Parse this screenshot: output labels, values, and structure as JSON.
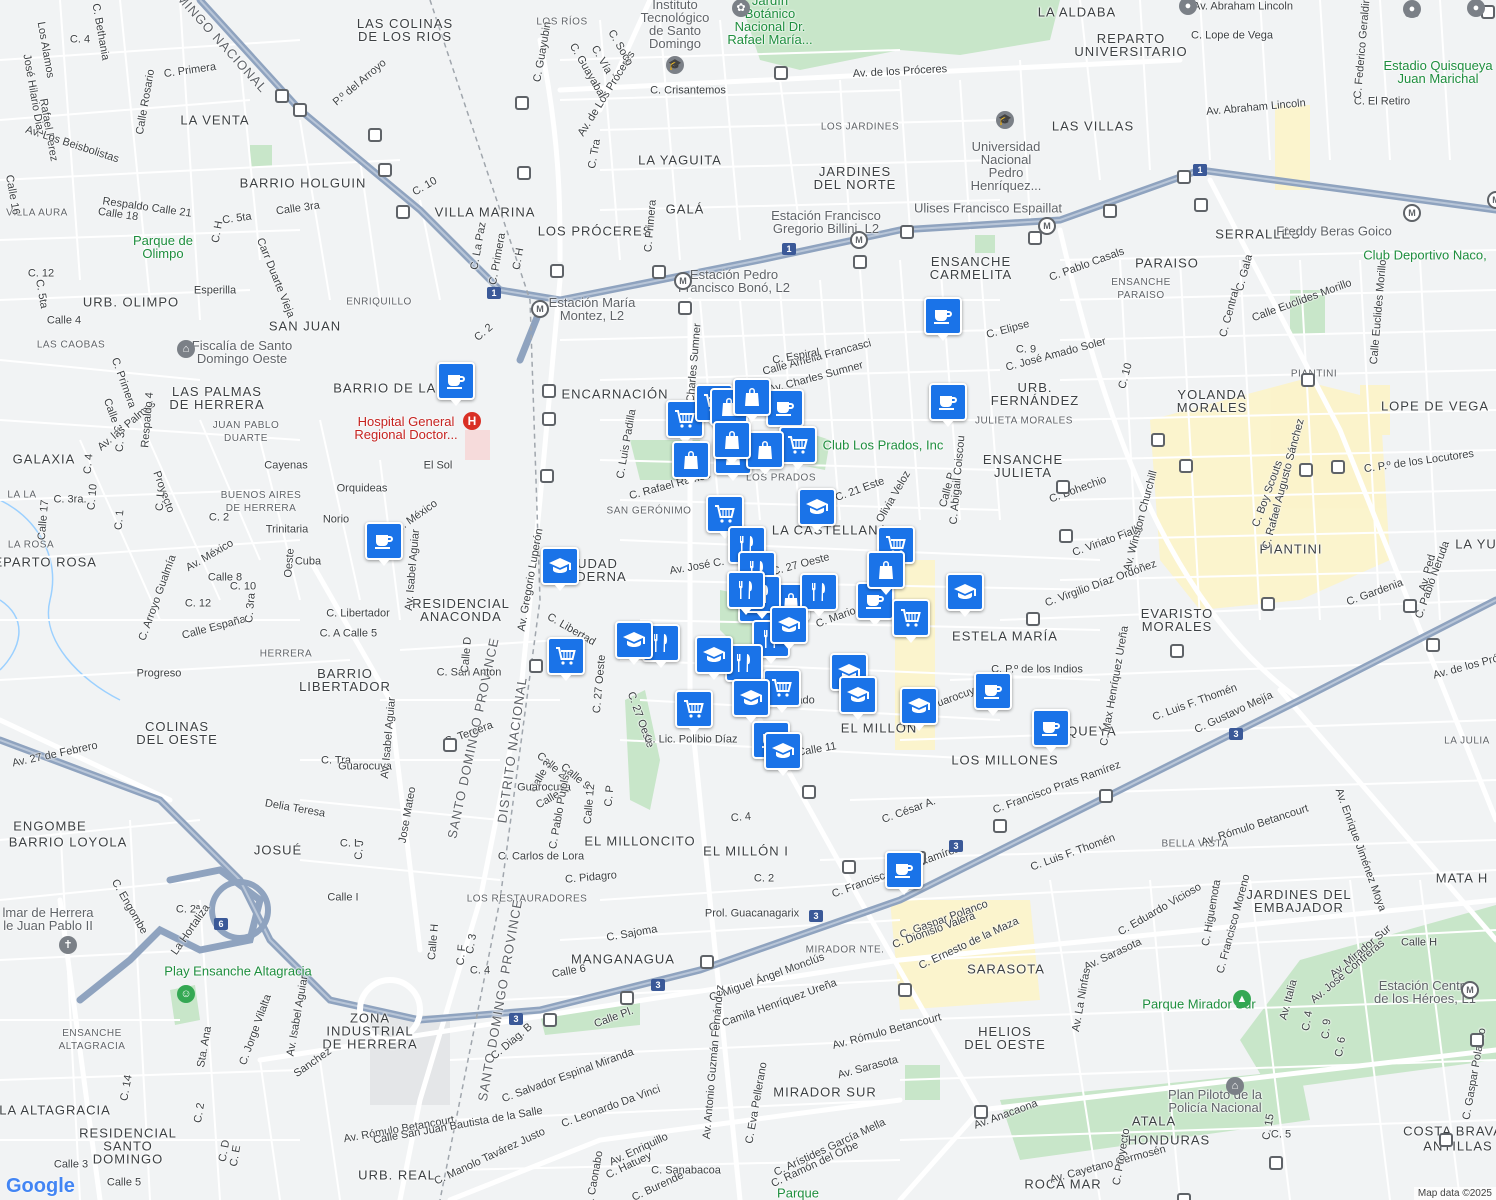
{
  "map": {
    "attribution": "Map data ©2025",
    "logo": "Google",
    "colors": {
      "background": "#f1f3f4",
      "road": "#ffffff",
      "highway": "#8fa3bf",
      "park": "#c8e6c9",
      "commercial": "#fdf3c5",
      "pin": "#1a73e8",
      "pin_dark": "#12355b"
    }
  },
  "areas": [
    {
      "name": "LAS COLINAS\nDE LOS RIOS"
    },
    {
      "name": "LA VENTA"
    },
    {
      "name": "BARRIO HOLGUIN"
    },
    {
      "name": "VILLA MARINA"
    },
    {
      "name": "LOS PRÓCERES"
    },
    {
      "name": "LA YAGUITA"
    },
    {
      "name": "GALÁ"
    },
    {
      "name": "URB. OLIMPO"
    },
    {
      "name": "SAN JUAN"
    },
    {
      "name": "ENCARNACIÓN"
    },
    {
      "name": "BARRIO DE LA FE"
    },
    {
      "name": "LAS PALMAS\nDE HERRERA"
    },
    {
      "name": "GALAXIA"
    },
    {
      "name": "LA CASTELLANA"
    },
    {
      "name": "CIUDAD\nMODERNA"
    },
    {
      "name": "RESIDENCIAL\nANACONDA"
    },
    {
      "name": "REPARTO ROSA"
    },
    {
      "name": "BARRIO\nLIBERTADOR"
    },
    {
      "name": "COLINAS\nDEL OESTE"
    },
    {
      "name": "ENGOMBE"
    },
    {
      "name": "BARRIO LOYOLA"
    },
    {
      "name": "JOSUÉ"
    },
    {
      "name": "EL MILLONCITO"
    },
    {
      "name": "EL MILLÓN I"
    },
    {
      "name": "MANGANAGUA"
    },
    {
      "name": "ZONA\nINDUSTRIAL\nDE HERRERA"
    },
    {
      "name": "LA ALTAGRACIA"
    },
    {
      "name": "RESIDENCIAL\nSANTO\nDOMINGO"
    },
    {
      "name": "URB. REAL"
    },
    {
      "name": "MIRADOR SUR"
    },
    {
      "name": "HELIOS\nDEL OESTE"
    },
    {
      "name": "SARASOTA"
    },
    {
      "name": "EL MILLÓN"
    },
    {
      "name": "LOS MILLONES"
    },
    {
      "name": "QUISQUEYA"
    },
    {
      "name": "ESTELA MARÍA"
    },
    {
      "name": "ENSANCHE\nJULIETA"
    },
    {
      "name": "URB.\nFERNÁNDEZ"
    },
    {
      "name": "ENSANCHE\nCARMELITA"
    },
    {
      "name": "JARDINES\nDEL NORTE"
    },
    {
      "name": "LAS VILLAS"
    },
    {
      "name": "REPARTO\nUNIVERSITARIO"
    },
    {
      "name": "LA ALDABA"
    },
    {
      "name": "PARAISO"
    },
    {
      "name": "SERRALLÉS"
    },
    {
      "name": "YOLANDA\nMORALES"
    },
    {
      "name": "LOPE DE VEGA"
    },
    {
      "name": "PIANTINI"
    },
    {
      "name": "EVARISTO\nMORALES"
    },
    {
      "name": "JARDINES DEL\nEMBAJADOR"
    },
    {
      "name": "ATALA"
    },
    {
      "name": "HONDURAS"
    },
    {
      "name": "ROCA MAR"
    },
    {
      "name": "COSTA BRAVA"
    },
    {
      "name": "ANTILLAS"
    },
    {
      "name": "MATA H"
    },
    {
      "name": "LA YU"
    }
  ],
  "small_areas": [
    "LOS RÍOS",
    "LOS JARDINES",
    "ENSANCHE\nPARAISO",
    "PIANTINI",
    "JULIETA MORALES",
    "LOS PRADOS",
    "SAN GERÓNIMO",
    "ENRIQUILLO",
    "LAS CAOBAS",
    "JUAN PABLO\nDUARTE",
    "BUENOS AIRES\nDE HERRERA",
    "HERRERA",
    "LA ROSA",
    "VILLA AURA",
    "LOS RESTAURADORES",
    "MIRADOR NTE.",
    "ENSANCHE\nALTAGRACIA",
    "BELLA VISTA",
    "LA JULIA",
    "LA LA"
  ],
  "places": [
    {
      "name": "Jardín\nBotánico\nNacional Dr.\nRafael María...",
      "kind": "park"
    },
    {
      "name": "Instituto\nTecnológico\nde Santo\nDomingo",
      "kind": "poi"
    },
    {
      "name": "Universidad\nNacional\nPedro\nHenríquez...",
      "kind": "poi"
    },
    {
      "name": "Parque de\nOlimpo",
      "kind": "park"
    },
    {
      "name": "Fiscalía de Santo\nDomingo Oeste",
      "kind": "poi"
    },
    {
      "name": "Hospital General\nRegional Doctor...",
      "kind": "hosp"
    },
    {
      "name": "Club Los Prados, Inc",
      "kind": "park"
    },
    {
      "name": "Estadio Quisqueya\nJuan Marichal",
      "kind": "park"
    },
    {
      "name": "Club Deportivo Naco,",
      "kind": "park"
    },
    {
      "name": "Parque Mirador Sur",
      "kind": "park"
    },
    {
      "name": "Plan Piloto de la\nPolicía Nacional",
      "kind": "poi"
    },
    {
      "name": "Play Ensanche Altagracia",
      "kind": "park"
    },
    {
      "name": "Estación Centro\nde los Héroes, L1",
      "kind": "poi"
    },
    {
      "name": "Estación Pedro\nFrancisco Bonó, L2",
      "kind": "poi"
    },
    {
      "name": "Estación María\nMontez, L2",
      "kind": "poi"
    },
    {
      "name": "Estación Francisco\nGregorio Billini, L2",
      "kind": "poi"
    },
    {
      "name": "Ulises Francisco Espaillat",
      "kind": "poi"
    },
    {
      "name": "Freddy Beras Goico",
      "kind": "poi"
    },
    {
      "name": "lmar de Herrera\nle Juan Pablo II",
      "kind": "poi"
    },
    {
      "name": "Parque",
      "kind": "park"
    }
  ],
  "admin_labels": [
    "SANTO DOMINGO PROVINCE",
    "DISTRITO NACIONAL",
    "SANTO DOMINGO PROVINCE",
    "DOMINGO NACIONAL"
  ],
  "streets": [
    "Av. de los Próceres",
    "C. Crisantemos",
    "Av. de Los Próceres",
    "C. Guayubin",
    "C. Soco",
    "C. Guayabal",
    "C. Vía",
    "C. Tra",
    "P.º del Arroyo",
    "C. Primera",
    "Calle Rosario",
    "Rafael Perez",
    "José Hilario Diaz",
    "Los Alamos",
    "C. Bethania",
    "C. 4",
    "Av. Los Beisbolistas",
    "Respaldo Calle 21",
    "Calle 18",
    "C. 5ta",
    "Calle 3ra",
    "C. H",
    "C. 10",
    "Carr Duarte Vieja",
    "Esperilla",
    "C. La Paz",
    "C. Primera",
    "C. H",
    "Calle 16",
    "C. 12",
    "C. 5ta",
    "Calle 4",
    "C. 2",
    "C. Primera",
    "Calle 31",
    "Av. las Palmas",
    "Respaldo 4",
    "C. 3",
    "C. 4",
    "C. 10",
    "C. 3ra.",
    "Proyecto",
    "C. L",
    "Calle 17",
    "C. 1",
    "C. 2",
    "Norio",
    "Orquideas",
    "El Sol",
    "Cayenas",
    "Trinitaria",
    "Av. México",
    "Cuba",
    "Oeste",
    "C. Libertador",
    "Calle 5",
    "C. A",
    "Calle España",
    "C. 12",
    "Calle 8",
    "C. 10",
    "C. 3ra",
    "C. Arroyo Gualmía",
    "Av. México",
    "Progreso",
    "C. San Anton",
    "Calle D",
    "Av. Isabel Aguiar",
    "Av. Gregorio Luperón",
    "C. Libertad",
    "C. 27 Oeste",
    "C. Tercera",
    "C. Tra",
    "Guarocuya",
    "Av. Isabel Aguiar",
    "Delia Teresa",
    "Jose Mateo",
    "C. J",
    "C. L",
    "Calle I",
    "C. 2ª",
    "La Hortaliza",
    "C. Engombe",
    "Av. 27 de Febrero",
    "C. 27 Oeste",
    "Calle 2",
    "Calle 3",
    "Calle 6",
    "Calle 9",
    "Calle 12",
    "C. P",
    "Guarocuya",
    "C. Pablo Pujols",
    "C. Carlos de Lora",
    "C. Pidagro",
    "C. 4",
    "C. 2",
    "Prol. Guacanagarix",
    "C. Sajoma",
    "Calle 6",
    "C. 4",
    "C. 3",
    "C. F",
    "Calle H",
    "Av. Isabel Aguiar",
    "C. Jorge Vilalta",
    "Sanchez",
    "Sta. Ana",
    "C. 14",
    "C. 2",
    "C. D",
    "C. E",
    "Calle 3",
    "Calle 5",
    "Av. Rómulo Betancourt",
    "C. Manolo Tavárez Justo",
    "Av. Enriquillo",
    "C. Leonardo Da Vinci",
    "Calle San Juan Bautista de la Salle",
    "C. Salvador Espinal Miranda",
    "C. Diag. B",
    "Calle Pl.",
    "C. Miguel Ángel Monclús",
    "C. Camila Henríquez Ureña",
    "Av. Rómulo Betancourt",
    "C. Eva Pellerano",
    "C. Arístides García Mella",
    "C. Ramón del Orbe",
    "C. Sanabacoa",
    "C. Hatuey",
    "C. Burende",
    "C. Caonabo",
    "Av. Antonio Guzmán Fernández",
    "Av. Sarasota",
    "Av. Anacaona",
    "Av. Cayetano Germosén",
    "Av. Sarasota",
    "C. Gaspar Polanco",
    "C. Dionisio Valera",
    "C. Ernesto de la Maza",
    "Av. La Ninfas",
    "C. Eduardo Vicioso",
    "C. Higuemota",
    "C. Francisco Moreno",
    "Av. Rómulo Betancourt",
    "Av. Enrique Jiménez Moya",
    "Av. Mirador Sur",
    "Av. José Contreras",
    "Av. Italia",
    "C. Proyecto",
    "C. 15",
    "C. 5",
    "C. 6",
    "C. 9",
    "C. 4",
    "Calle H",
    "C. Gaspar Polanco",
    "C. Luis F. Thomén",
    "C. Francisco Prats Ramírez",
    "C. Luis F. Thomén",
    "C. Francisco Prats Ramírez",
    "C. Gustavo Mejía",
    "C. César A.",
    "C. Mario",
    "Alvarado",
    "Guarocuya",
    "C. P.º de los Indios",
    "Calle 11",
    "C. Lic. Polibio Díaz",
    "C. Max Henríquez Ureña",
    "C. Virgilio Díaz Ordóñez",
    "C. Viriato Fiallo",
    "Av. Winston Churchill",
    "C. Bohechio",
    "C. 10",
    "Calle P",
    "C. Abigail Coiscou",
    "Olivia Veloz",
    "C. 21 Este",
    "C. 27 Oeste",
    "C. Rafael Ramos",
    "Av. José C.",
    "C. Luis Padilla",
    "C. Charles Sumner",
    "Calle Amelia Francasci",
    "Av. Charles Sumner",
    "C. Espiral",
    "C. Elipse",
    "C. 9",
    "C. José Amado Soler",
    "C. Pablo Casals",
    "Calle Euclides Morillo",
    "Calle Euclides Morillo",
    "Av. Abraham Lincoln",
    "C. El Retiro",
    "C. Gala",
    "C. Central",
    "C. Lope de Vega",
    "Av. Abraham Lincoln",
    "C. Federico Geraldino",
    "C. Pablo Neruda",
    "C. Rafael Augusto Sánchez",
    "C. Boy Scouts",
    "C. P.º de los Locutores",
    "Av. Ped",
    "C. Gardenia",
    "Av. de los Próceres",
    "C. Primera"
  ],
  "pins_legend": {
    "cafe": "coffee-cup",
    "shop": "shopping-bag",
    "grocery": "shopping-cart",
    "food": "fork-knife",
    "school": "graduation-cap"
  },
  "route_shields": [
    "1",
    "1",
    "1",
    "1",
    "3",
    "3",
    "3",
    "3",
    "3",
    "6"
  ]
}
